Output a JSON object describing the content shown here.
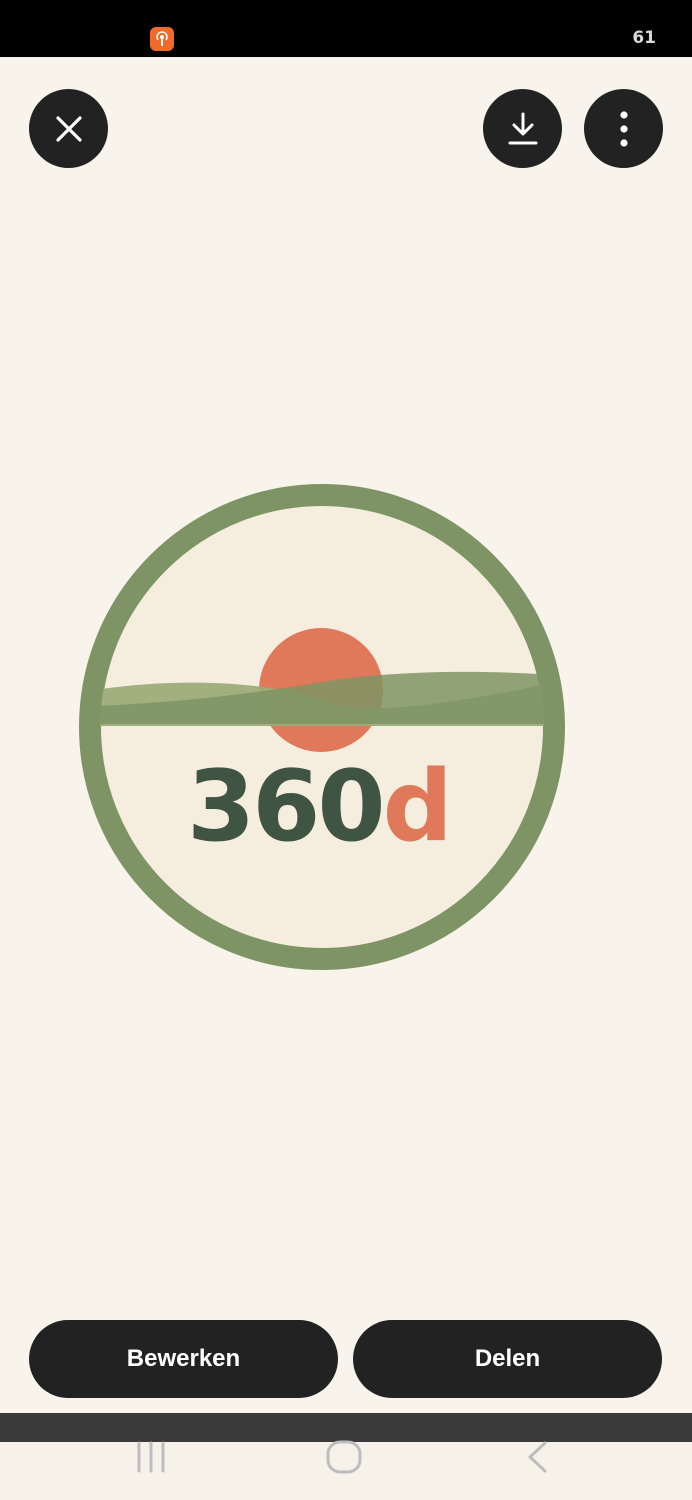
{
  "status_bar": {
    "right_text": "61",
    "app_icon": "podcast-broadcast-icon",
    "app_icon_color": "#f06a2a"
  },
  "toolbar": {
    "close_icon": "close-icon",
    "download_icon": "download-icon",
    "more_icon": "more-vertical-icon"
  },
  "image": {
    "logo_text_main": "360",
    "logo_text_accent": "d",
    "colors": {
      "ring": "#7e9464",
      "fill": "#f5eddd",
      "sun": "#e0785a",
      "text_dark": "#3f5443",
      "text_accent": "#e0785a"
    }
  },
  "actions": {
    "edit_label": "Bewerken",
    "share_label": "Delen"
  },
  "nav": {
    "recents_icon": "recent-apps-icon",
    "home_icon": "home-icon",
    "back_icon": "back-icon"
  }
}
